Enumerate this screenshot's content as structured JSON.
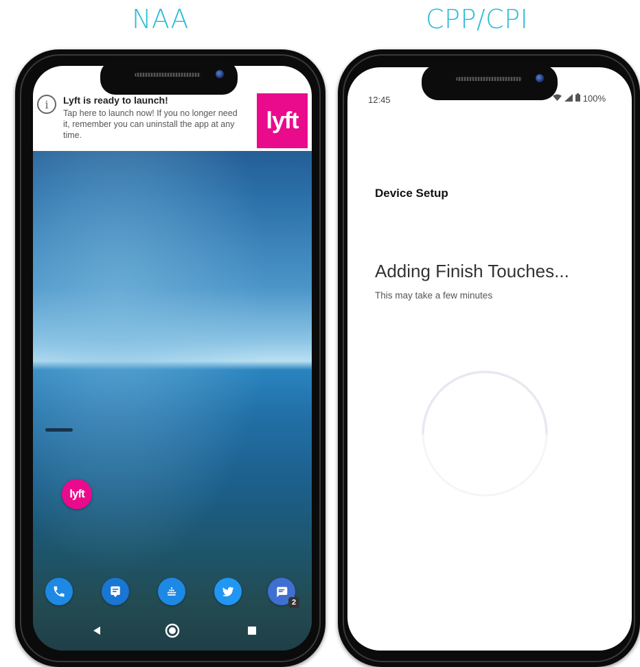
{
  "headings": {
    "left": "NAA",
    "right": "CPP/CPI"
  },
  "left_phone": {
    "notification": {
      "title": "Lyft is ready to launch!",
      "body": "Tap here to launch now! If you no longer need it, remember you can uninstall the app at any time.",
      "logo_text": "lyft"
    },
    "home_app_icon": "lyft",
    "dock": {
      "icons": [
        "phone-icon",
        "chat-icon",
        "app-drawer-icon",
        "twitter-icon",
        "messages-icon"
      ],
      "messages_badge": "2"
    },
    "nav": [
      "back-icon",
      "home-icon",
      "recents-icon"
    ]
  },
  "right_phone": {
    "status": {
      "time": "12:45",
      "battery": "100%"
    },
    "setup_label": "Device Setup",
    "title": "Adding Finish Touches...",
    "subtitle": "This may take a few minutes"
  },
  "colors": {
    "heading": "#2bbcd6",
    "lyft_pink": "#ea0b8c",
    "dock_blue": "#1e88e5"
  }
}
